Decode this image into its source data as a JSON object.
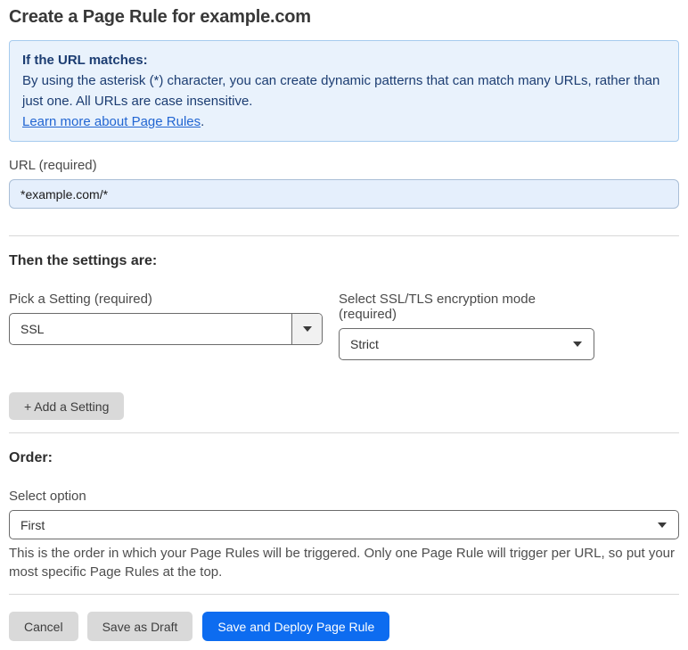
{
  "page": {
    "title": "Create a Page Rule for example.com"
  },
  "info_box": {
    "heading": "If the URL matches:",
    "body": "By using the asterisk (*) character, you can create dynamic patterns that can match many URLs, rather than just one. All URLs are case insensitive.",
    "link": "Learn more about Page Rules",
    "link_suffix": "."
  },
  "url_field": {
    "label": "URL (required)",
    "value": "*example.com/*"
  },
  "settings_section": {
    "heading": "Then the settings are:",
    "setting_picker": {
      "label": "Pick a Setting (required)",
      "value": "SSL"
    },
    "ssl_mode": {
      "label": "Select SSL/TLS encryption mode (required)",
      "value": "Strict"
    },
    "add_setting_label": "+ Add a Setting"
  },
  "order_section": {
    "heading": "Order:",
    "select_label": "Select option",
    "value": "First",
    "help_text": "This is the order in which your Page Rules will be triggered. Only one Page Rule will trigger per URL, so put your most specific Page Rules at the top."
  },
  "actions": {
    "cancel": "Cancel",
    "save_draft": "Save as Draft",
    "save_deploy": "Save and Deploy Page Rule"
  },
  "colors": {
    "accent_blue": "#0d6cf0",
    "info_bg": "#e9f2fc",
    "info_border": "#a6cbee",
    "info_text": "#1c3d72",
    "link_blue": "#2266d2",
    "input_bg": "#e5effc",
    "button_gray": "#d9d9d9"
  }
}
